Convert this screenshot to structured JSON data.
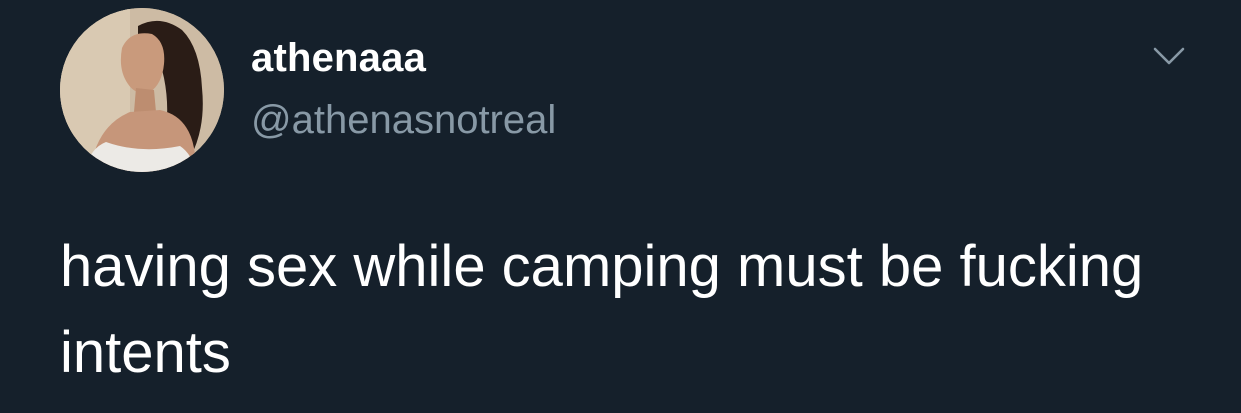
{
  "tweet": {
    "display_name": "athenaaa",
    "handle": "@athenasnotreal",
    "text": "having sex while camping must be fucking intents",
    "avatar_icon": "profile-photo",
    "menu_icon": "chevron-down-icon"
  },
  "colors": {
    "background": "#15202b",
    "name": "#ffffff",
    "handle": "#8899a6",
    "text": "#ffffff"
  }
}
